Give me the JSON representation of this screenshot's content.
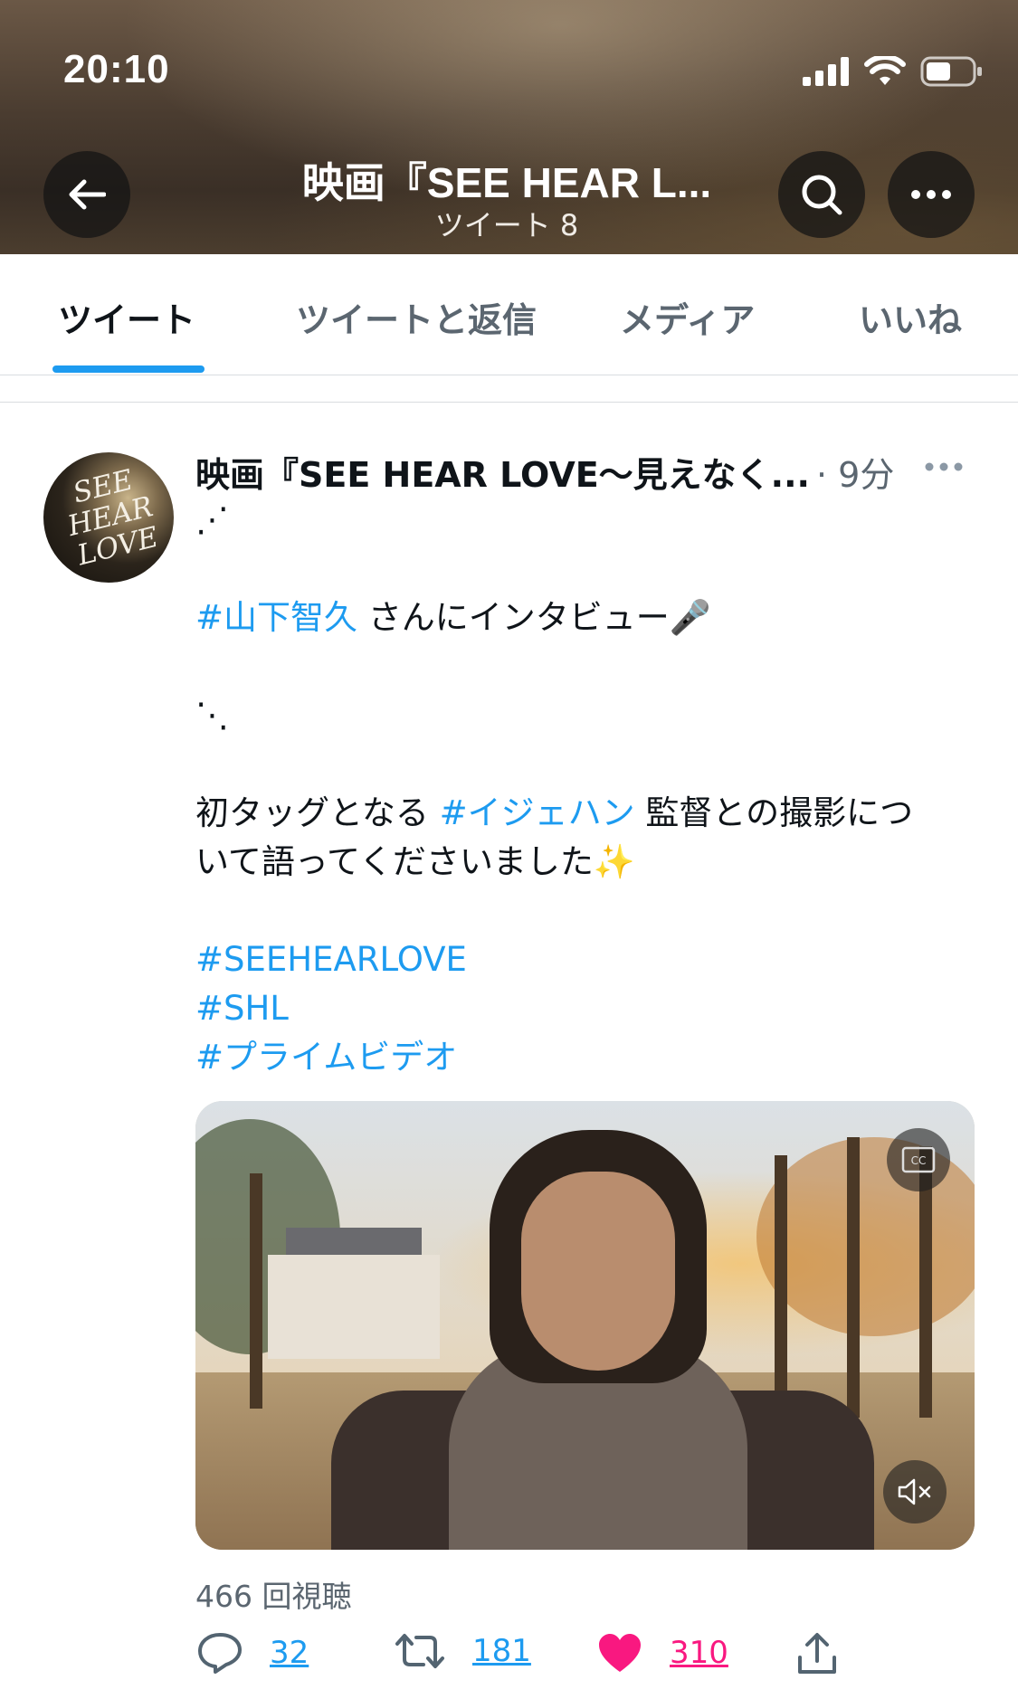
{
  "status_bar": {
    "time": "20:10"
  },
  "header": {
    "title": "映画『SEE HEAR L...",
    "subtitle": "ツイート 8"
  },
  "tabs": [
    {
      "label": "ツイート",
      "active": true
    },
    {
      "label": "ツイートと返信",
      "active": false
    },
    {
      "label": "メディア",
      "active": false
    },
    {
      "label": "いいね",
      "active": false
    }
  ],
  "tweet": {
    "avatar_text": "SEE HEAR LOVE",
    "author": "映画『SEE HEAR LOVE～見えなく...",
    "time": "· 9分",
    "text": {
      "line1": "⋰",
      "line2_tag": "#山下智久",
      "line2_rest": " さんにインタビュー🎤",
      "line3": "⋱",
      "line4_pre": "初タッグとなる ",
      "line4_tag": "#イジェハン",
      "line4_post": " 監督との撮影につ",
      "line5": "いて語ってくださいました✨",
      "tags": [
        "#SEEHEARLOVE",
        "#SHL",
        "#プライムビデオ"
      ]
    },
    "views": "466 回視聴",
    "actions": {
      "replies": "32",
      "retweets": "181",
      "likes": "310"
    }
  },
  "colors": {
    "accent": "#1d9bf0",
    "like": "#f91880",
    "secondary_text": "#5b6670"
  }
}
